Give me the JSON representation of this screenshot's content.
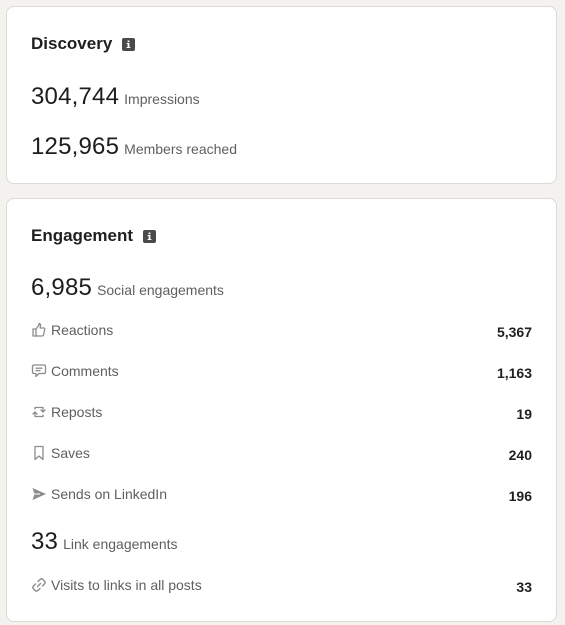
{
  "discovery": {
    "title": "Discovery",
    "info_icon": "info-icon",
    "impressions_value": "304,744",
    "impressions_label": "Impressions",
    "members_value": "125,965",
    "members_label": "Members reached"
  },
  "engagement": {
    "title": "Engagement",
    "info_icon": "info-icon",
    "social_value": "6,985",
    "social_label": "Social engagements",
    "rows": [
      {
        "icon": "thumbs-up-icon",
        "label": "Reactions",
        "value": "5,367"
      },
      {
        "icon": "comment-icon",
        "label": "Comments",
        "value": "1,163"
      },
      {
        "icon": "repost-icon",
        "label": "Reposts",
        "value": "19"
      },
      {
        "icon": "bookmark-icon",
        "label": "Saves",
        "value": "240"
      },
      {
        "icon": "send-icon",
        "label": "Sends on LinkedIn",
        "value": "196"
      }
    ],
    "link_value": "33",
    "link_label": "Link engagements",
    "link_row": {
      "icon": "link-icon",
      "label": "Visits to links in all posts",
      "value": "33"
    }
  },
  "colors": {
    "page_bg": "#f4f2ee",
    "card_bg": "#ffffff",
    "icon_gray": "#8c8c8c"
  }
}
